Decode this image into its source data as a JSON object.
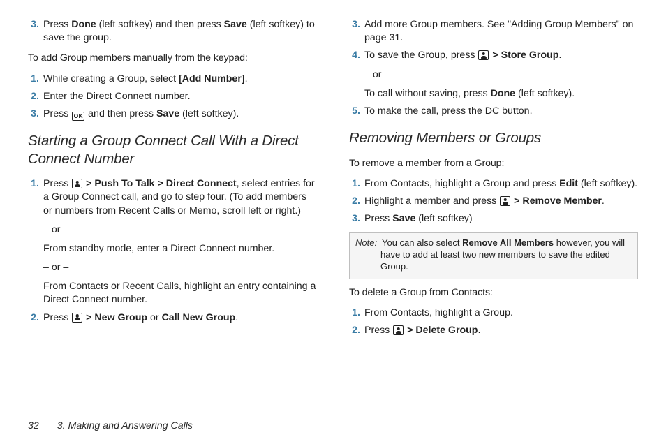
{
  "col1": {
    "topStep": {
      "num": "3.",
      "text_a": "Press ",
      "b1": "Done",
      "text_b": " (left softkey) and then press ",
      "b2": "Save",
      "text_c": " (left softkey) to save the group."
    },
    "intro1": "To add Group members manually from the keypad:",
    "s1": {
      "num": "1.",
      "a": "While creating a Group, select ",
      "b": "[Add Number]",
      "c": "."
    },
    "s2": {
      "num": "2.",
      "a": "Enter the Direct Connect number."
    },
    "s3": {
      "num": "3.",
      "a": "Press ",
      "icon_ok": "OK",
      "b": " and then press ",
      "b1": "Save",
      "c": " (left softkey)."
    },
    "h2": "Starting a Group Connect Call With a Direct Connect Number",
    "g1": {
      "num": "1.",
      "a": "Press ",
      "sep1": " > ",
      "b1": "Push To Talk",
      "sep2": " > ",
      "b2": "Direct Connect",
      "c": ", select entries for a Group Connect call, and go to step four. (To add members or numbers from Recent Calls or Memo, scroll left or right.)",
      "or1": "– or –",
      "p2": "From standby mode, enter a Direct Connect number.",
      "or2": "– or –",
      "p3": "From Contacts or Recent Calls, highlight an entry containing a Direct Connect number."
    },
    "g2": {
      "num": "2.",
      "a": "Press ",
      "sep": " > ",
      "b1": "New Group",
      "mid": " or ",
      "b2": "Call New Group",
      "c": "."
    }
  },
  "col2": {
    "r3": {
      "num": "3.",
      "a": "Add more Group members. See \"Adding Group Members\" on page 31."
    },
    "r4": {
      "num": "4.",
      "a": "To save the Group, press ",
      "sep": " > ",
      "b1": "Store Group",
      "c": ".",
      "or": "– or –",
      "p2a": "To call without saving, press ",
      "p2b": "Done",
      "p2c": " (left softkey)."
    },
    "r5": {
      "num": "5.",
      "a": "To make the call, press the DC button."
    },
    "h2": "Removing Members or Groups",
    "intro2": "To remove a member from a Group:",
    "m1": {
      "num": "1.",
      "a": "From Contacts, highlight a Group and press ",
      "b": "Edit",
      "c": " (left softkey)."
    },
    "m2": {
      "num": "2.",
      "a": "Highlight a member and press ",
      "sep": " > ",
      "b": "Remove Member",
      "c": "."
    },
    "m3": {
      "num": "3.",
      "a": "Press ",
      "b": "Save",
      "c": " (left softkey)"
    },
    "note": {
      "label": "Note:",
      "a": "You can also select ",
      "b": "Remove All Members",
      "c": " however, you will have to add at least two new members to save the edited Group."
    },
    "intro3": "To delete a Group from Contacts:",
    "d1": {
      "num": "1.",
      "a": "From Contacts, highlight a Group."
    },
    "d2": {
      "num": "2.",
      "a": "Press ",
      "sep": " > ",
      "b": "Delete Group",
      "c": "."
    }
  },
  "footer": {
    "page": "32",
    "title": "3. Making and Answering Calls"
  }
}
